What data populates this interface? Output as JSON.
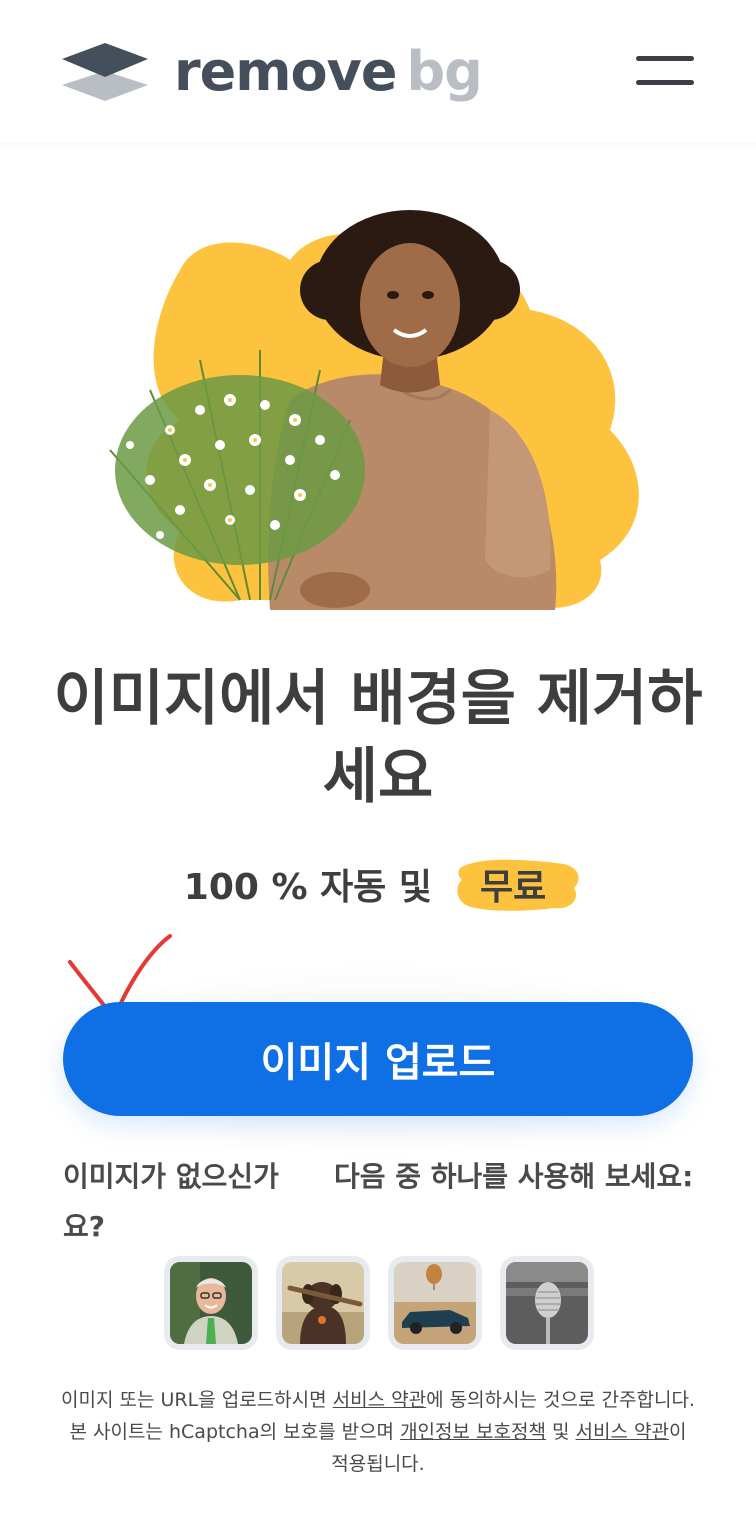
{
  "header": {
    "logo_remove": "remove",
    "logo_bg": "bg",
    "menu_icon": "hamburger-menu-icon"
  },
  "hero": {
    "image": "woman-holding-flowers",
    "blob_color": "#fdc23e"
  },
  "headline": "이미지에서 배경을 제거하세요",
  "subline": {
    "prefix": "100 % 자동 및",
    "highlight": "무료",
    "highlight_color": "#fdc23e"
  },
  "annotation": {
    "icon": "red-checkmark-icon",
    "color": "#e53935"
  },
  "upload": {
    "label": "이미지 업로드",
    "color": "#0f70e6"
  },
  "no_image": {
    "question": "이미지가 없으신가요?",
    "suggestion": "다음 중 하나를 사용해 보세요:"
  },
  "samples": [
    {
      "name": "sample-man-icon"
    },
    {
      "name": "sample-dog-icon"
    },
    {
      "name": "sample-car-icon"
    },
    {
      "name": "sample-microphone-icon"
    }
  ],
  "legal": {
    "line1_a": "이미지 또는 URL을 업로드하시면 ",
    "terms_1": "서비스 약관",
    "line1_b": "에 동의하시는 것으로 간주합니다.",
    "line2_a": "본 사이트는 hCaptcha의 보호를 받으며 ",
    "privacy": "개인정보 보호정책",
    "line2_b": " 및 ",
    "terms_2": "서비스 약관",
    "line2_c": "이",
    "line3": "적용됩니다."
  }
}
